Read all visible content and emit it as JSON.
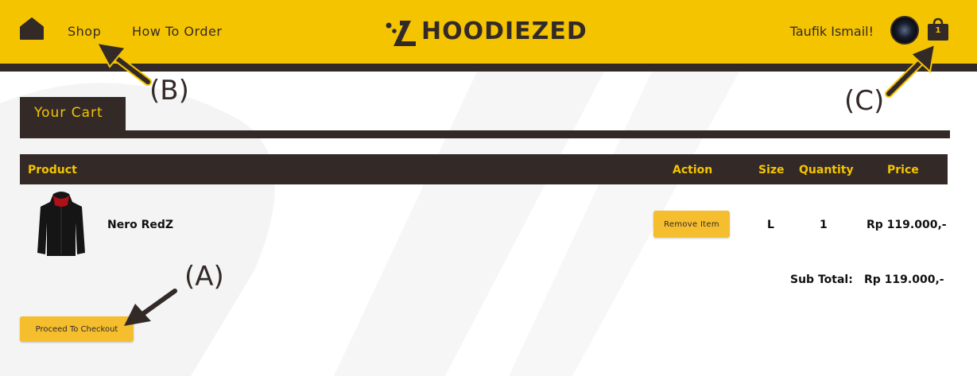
{
  "header": {
    "nav": [
      "Shop",
      "How To Order"
    ],
    "logo_text": "HOODIEZED",
    "user_name": "Taufik Ismail!",
    "cart_count": "1",
    "brand_color": "#f5c400",
    "dark_color": "#332a28"
  },
  "cart": {
    "tab_label": "Your Cart",
    "columns": [
      "Product",
      "Action",
      "Size",
      "Quantity",
      "Price"
    ],
    "items": [
      {
        "name": "Nero RedZ",
        "action": "Remove Item",
        "size": "L",
        "quantity": "1",
        "price": "Rp 119.000,-"
      }
    ],
    "subtotal_label": "Sub Total:",
    "subtotal_value": "Rp 119.000,-",
    "checkout_label": "Proceed To Checkout"
  },
  "annotations": [
    "(A)",
    "(B)",
    "(C)"
  ]
}
